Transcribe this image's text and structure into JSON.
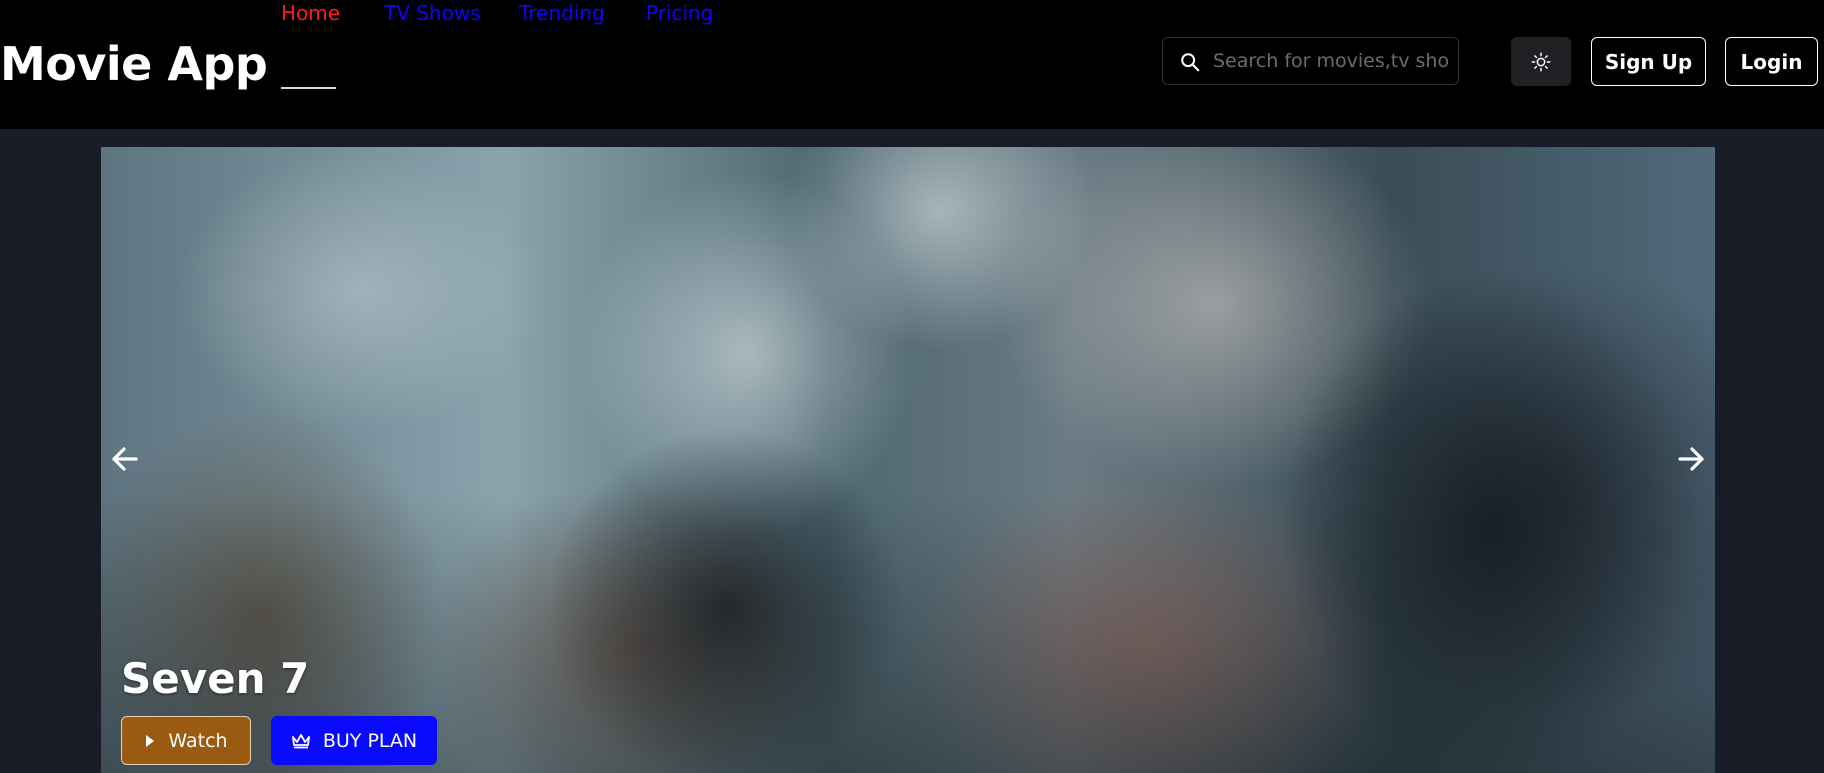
{
  "header": {
    "brand": "Movie App",
    "nav": [
      {
        "label": "Home",
        "active": true
      },
      {
        "label": "TV Shows",
        "active": false
      },
      {
        "label": "Trending",
        "active": false
      },
      {
        "label": "Pricing",
        "active": false
      }
    ],
    "search": {
      "placeholder": "Search for movies,tv shows",
      "value": ""
    },
    "theme_icon": "sun-icon",
    "signup_label": "Sign Up",
    "login_label": "Login"
  },
  "hero": {
    "title": "Seven 7",
    "watch_label": "Watch",
    "watch_icon": "play-icon",
    "buy_label": "BUY PLAN",
    "buy_icon": "crown-icon",
    "prev_icon": "arrow-left-icon",
    "next_icon": "arrow-right-icon"
  },
  "colors": {
    "header_bg": "#000000",
    "page_bg": "#171c26",
    "nav_active": "#ff1a1a",
    "nav_link": "#1400ff",
    "watch_bg": "#9b5a12",
    "buy_bg": "#0a0aff"
  }
}
